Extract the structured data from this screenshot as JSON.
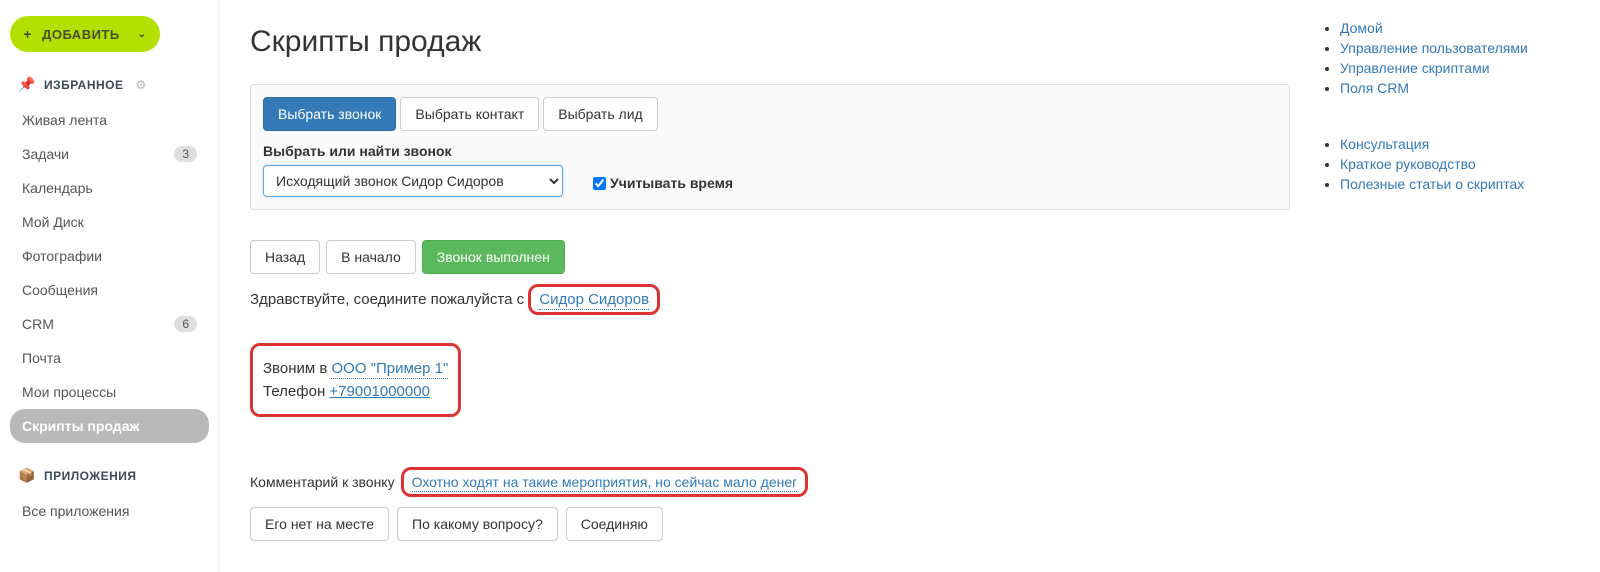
{
  "sidebar": {
    "add_button": "ДОБАВИТЬ",
    "favorites_title": "ИЗБРАННОЕ",
    "items": [
      {
        "label": "Живая лента",
        "badge": null,
        "active": false
      },
      {
        "label": "Задачи",
        "badge": "3",
        "active": false
      },
      {
        "label": "Календарь",
        "badge": null,
        "active": false
      },
      {
        "label": "Мой Диск",
        "badge": null,
        "active": false
      },
      {
        "label": "Фотографии",
        "badge": null,
        "active": false
      },
      {
        "label": "Сообщения",
        "badge": null,
        "active": false
      },
      {
        "label": "CRM",
        "badge": "6",
        "active": false
      },
      {
        "label": "Почта",
        "badge": null,
        "active": false
      },
      {
        "label": "Мои процессы",
        "badge": null,
        "active": false
      },
      {
        "label": "Скрипты продаж",
        "badge": null,
        "active": true
      }
    ],
    "apps_title": "ПРИЛОЖЕНИЯ",
    "apps_items": [
      {
        "label": "Все приложения"
      }
    ]
  },
  "page": {
    "title": "Скрипты продаж"
  },
  "panel": {
    "tabs": [
      {
        "label": "Выбрать звонок",
        "active": true
      },
      {
        "label": "Выбрать контакт",
        "active": false
      },
      {
        "label": "Выбрать лид",
        "active": false
      }
    ],
    "select_label": "Выбрать или найти звонок",
    "select_value": "Исходящий звонок Сидор Сидоров",
    "checkbox_label": "Учитывать время",
    "checkbox_checked": true
  },
  "actions": {
    "back": "Назад",
    "start": "В начало",
    "done": "Звонок выполнен"
  },
  "script": {
    "greeting_prefix": "Здравствуйте, соедините пожалуйста с ",
    "greeting_name": "Сидор Сидоров",
    "calling_prefix": "Звоним в ",
    "company": "ООО \"Пример 1\"",
    "phone_label": "Телефон ",
    "phone": "+79001000000",
    "comment_label": "Комментарий к звонку",
    "comment_text": "Охотно ходят на такие мероприятия, но сейчас мало денег",
    "options": [
      "Его нет на месте",
      "По какому вопросу?",
      "Соединяю"
    ]
  },
  "right": {
    "links1": [
      "Домой",
      "Управление пользователями",
      "Управление скриптами",
      "Поля CRM"
    ],
    "links2": [
      "Консультация",
      "Краткое руководство",
      "Полезные статьи о скриптах"
    ]
  }
}
